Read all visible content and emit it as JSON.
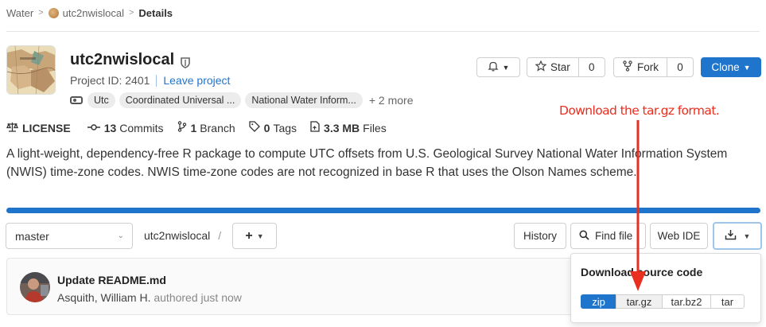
{
  "breadcrumb": {
    "root": "Water",
    "project": "utc2nwislocal",
    "current": "Details"
  },
  "project": {
    "name": "utc2nwislocal",
    "id_text": "Project ID: 2401",
    "leave_link": "Leave project",
    "topics": [
      "Utc",
      "Coordinated Universal ...",
      "National Water Inform..."
    ],
    "more_topics": "+ 2 more"
  },
  "actions": {
    "star_label": "Star",
    "star_count": "0",
    "fork_label": "Fork",
    "fork_count": "0",
    "clone_label": "Clone"
  },
  "stats": {
    "license": "LICENSE",
    "commits_count": "13",
    "commits_label": "Commits",
    "branch_count": "1",
    "branch_label": "Branch",
    "tags_count": "0",
    "tags_label": "Tags",
    "files_size": "3.3 MB",
    "files_label": "Files"
  },
  "description": "A light-weight, dependency-free R package to compute UTC offsets from U.S. Geological Survey National Water Information System (NWIS) time-zone codes. NWIS time-zone codes are not recognized in base R that uses the Olson Names scheme.",
  "repo": {
    "branch": "master",
    "path": "utc2nwislocal",
    "path_sep": "/",
    "add_label": "+",
    "history_label": "History",
    "find_file_label": "Find file",
    "web_ide_label": "Web IDE"
  },
  "commit": {
    "title": "Update README.md",
    "author": "Asquith, William H.",
    "authored": "authored just now"
  },
  "download_menu": {
    "title": "Download source code",
    "formats": [
      "zip",
      "tar.gz",
      "tar.bz2",
      "tar"
    ]
  },
  "annotation": {
    "text": "Download the tar.gz format.",
    "color": "#ea2e1f"
  },
  "colors": {
    "accent": "#1f75cb",
    "annotation": "#ea2e1f"
  }
}
